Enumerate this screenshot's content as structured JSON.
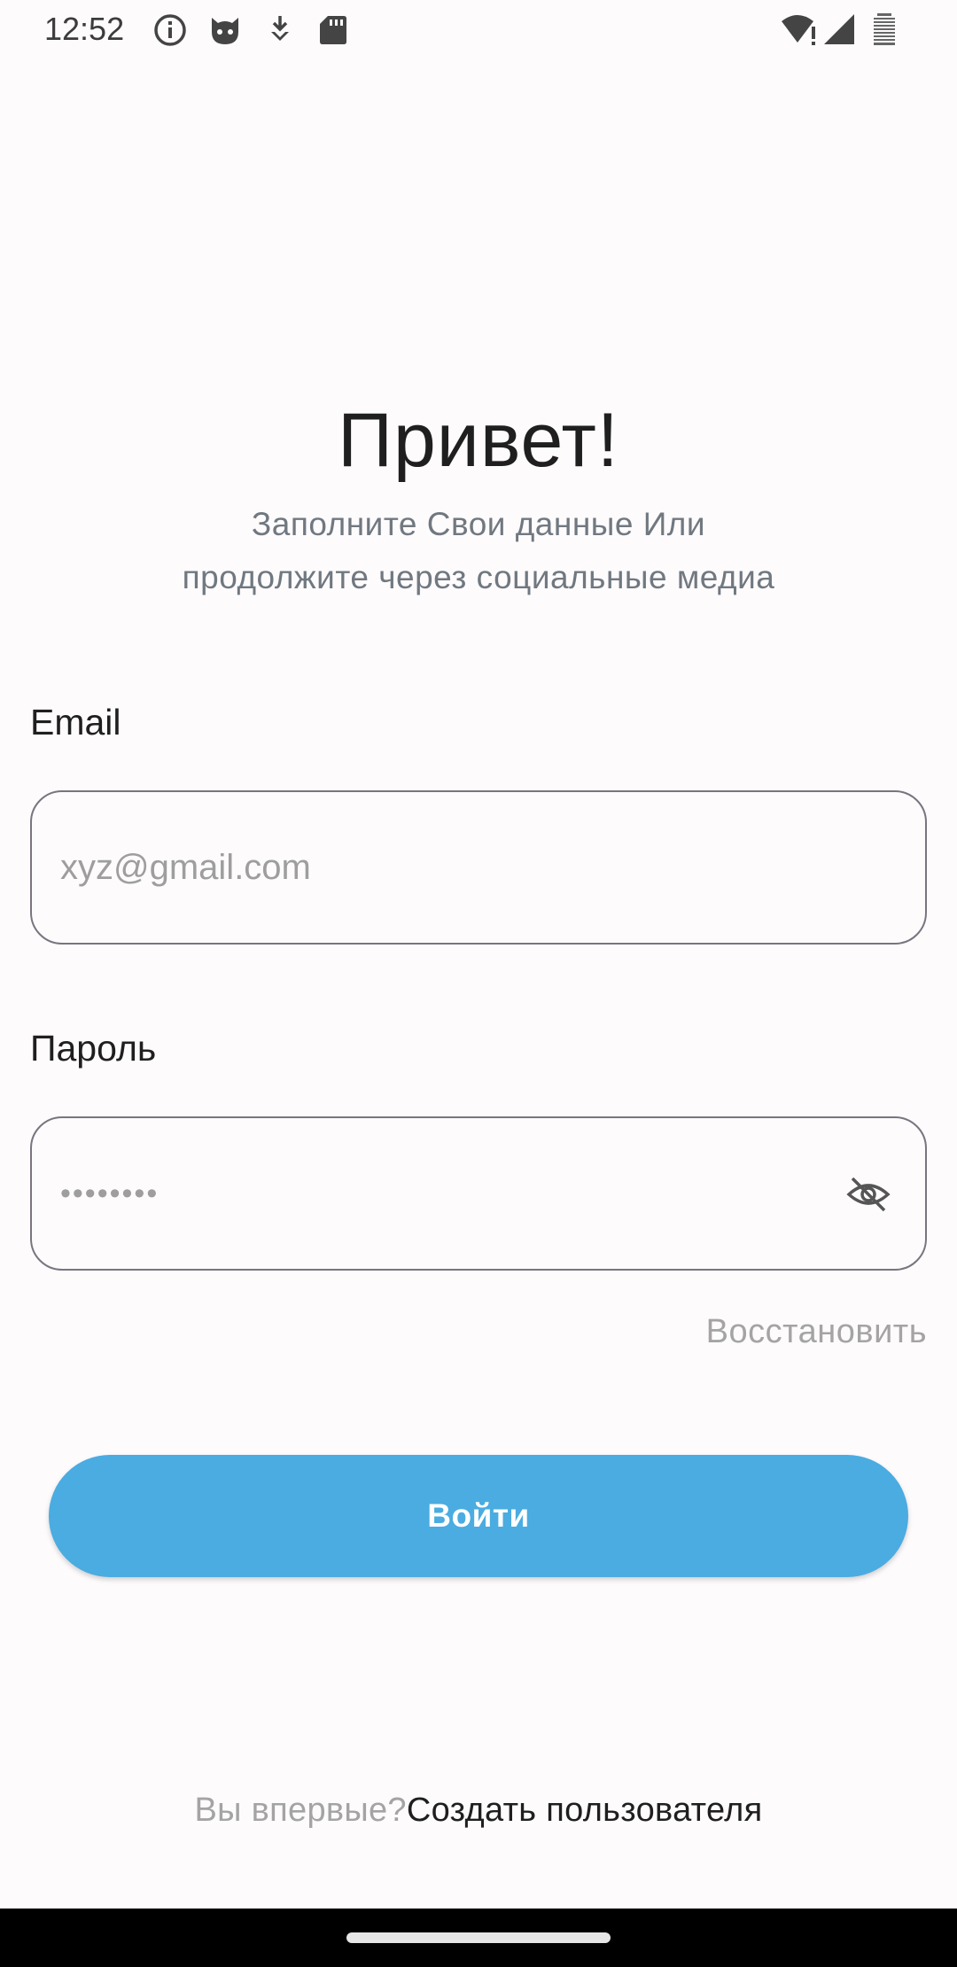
{
  "status_bar": {
    "time": "12:52",
    "left_icons": [
      "info-icon",
      "cat-icon",
      "download-icon",
      "sd-card-icon"
    ],
    "right_icons": [
      "wifi-alert-icon",
      "signal-icon",
      "battery-icon"
    ]
  },
  "header": {
    "title": "Привет!",
    "subtitle_line1": "Заполните Свои данные Или",
    "subtitle_line2": "продолжите через социальные медиа"
  },
  "email": {
    "label": "Email",
    "placeholder": "xyz@gmail.com",
    "value": ""
  },
  "password": {
    "label": "Пароль",
    "value": "••••••••",
    "visibility_icon": "eye-off-icon"
  },
  "links": {
    "recover": "Восстановить"
  },
  "login_button": {
    "label": "Войти"
  },
  "signup": {
    "prompt": "Вы впервые?",
    "link": "Создать пользователя"
  },
  "colors": {
    "accent": "#4aace1",
    "background": "#fefbfd",
    "border": "#79747e",
    "muted_text": "#a4a4a4"
  }
}
